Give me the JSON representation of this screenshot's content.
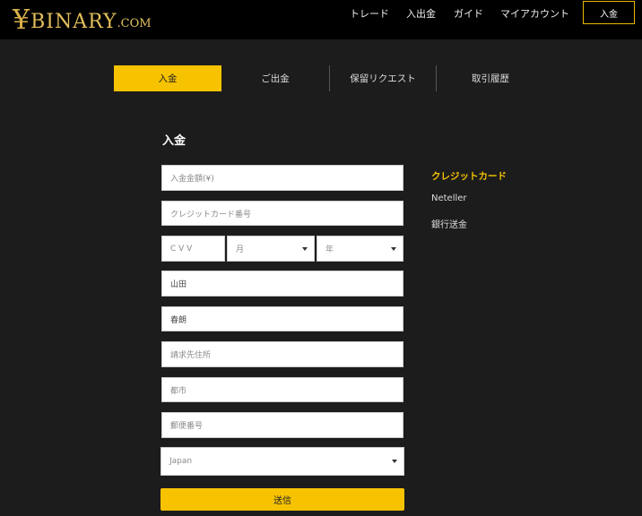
{
  "logo": {
    "yen": "¥",
    "text": "BINARY",
    "suffix": ".COM"
  },
  "nav": {
    "items": [
      "トレード",
      "入出金",
      "ガイド",
      "マイアカウント"
    ],
    "deposit_button": "入金"
  },
  "tabs": [
    "入金",
    "ご出金",
    "保留リクエスト",
    "取引履歴"
  ],
  "form": {
    "title": "入金",
    "amount_placeholder": "入金金額(¥)",
    "card_number_placeholder": "クレジットカード番号",
    "cvv_placeholder": "C V V",
    "month_placeholder": "月",
    "year_placeholder": "年",
    "last_name": "山田",
    "first_name": "春朗",
    "address_placeholder": "請求先住所",
    "city_placeholder": "都市",
    "postal_placeholder": "郵便番号",
    "country": "Japan",
    "submit_label": "送信"
  },
  "side_menu": {
    "items": [
      "クレジットカード",
      "Neteller",
      "銀行送金"
    ],
    "active": "クレジットカード"
  },
  "colors": {
    "accent": "#f7c300",
    "header_bg": "#000000",
    "page_bg": "#1c1c1c"
  }
}
